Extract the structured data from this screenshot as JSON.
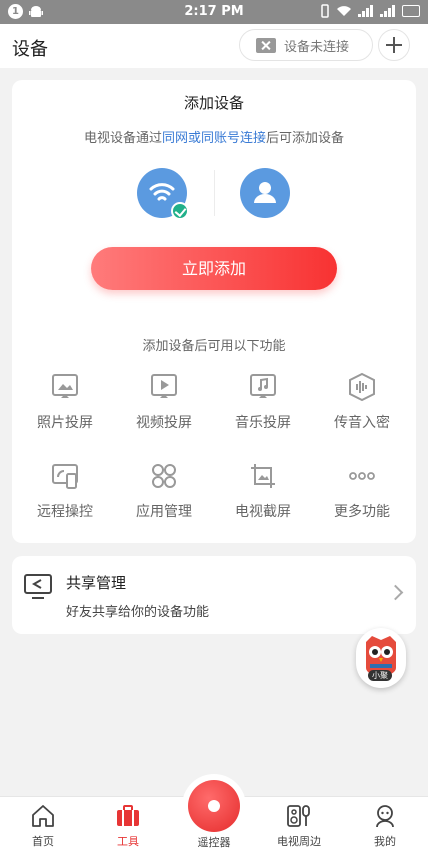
{
  "status_bar": {
    "time": "2:17 PM",
    "notification_count": "1"
  },
  "header": {
    "title": "设备",
    "connection_status": "设备未连接"
  },
  "add_device": {
    "title": "添加设备",
    "hint_prefix": "电视设备通过",
    "hint_link": "同网或同账号连接",
    "hint_suffix": "后可添加设备",
    "button": "立即添加",
    "features_title": "添加设备后可用以下功能",
    "features": [
      {
        "label": "照片投屏",
        "icon": "photo-cast-icon"
      },
      {
        "label": "视频投屏",
        "icon": "video-cast-icon"
      },
      {
        "label": "音乐投屏",
        "icon": "music-cast-icon"
      },
      {
        "label": "传音入密",
        "icon": "voice-icon"
      },
      {
        "label": "远程操控",
        "icon": "remote-control-icon"
      },
      {
        "label": "应用管理",
        "icon": "apps-icon"
      },
      {
        "label": "电视截屏",
        "icon": "screenshot-icon"
      },
      {
        "label": "更多功能",
        "icon": "more-icon"
      }
    ]
  },
  "share": {
    "title": "共享管理",
    "subtitle": "好友共享给你的设备功能"
  },
  "mascot": {
    "label": "小聚"
  },
  "tabbar": {
    "items": [
      {
        "label": "首页",
        "icon": "home-icon"
      },
      {
        "label": "工具",
        "icon": "toolbox-icon",
        "active": true
      },
      {
        "label": "遥控器",
        "icon": "remote-icon"
      },
      {
        "label": "电视周边",
        "icon": "speaker-icon"
      },
      {
        "label": "我的",
        "icon": "profile-icon"
      }
    ]
  },
  "colors": {
    "accent": "#e73535",
    "link": "#3a7bd5",
    "device_icon": "#5b9ae0",
    "check": "#21b08a"
  }
}
